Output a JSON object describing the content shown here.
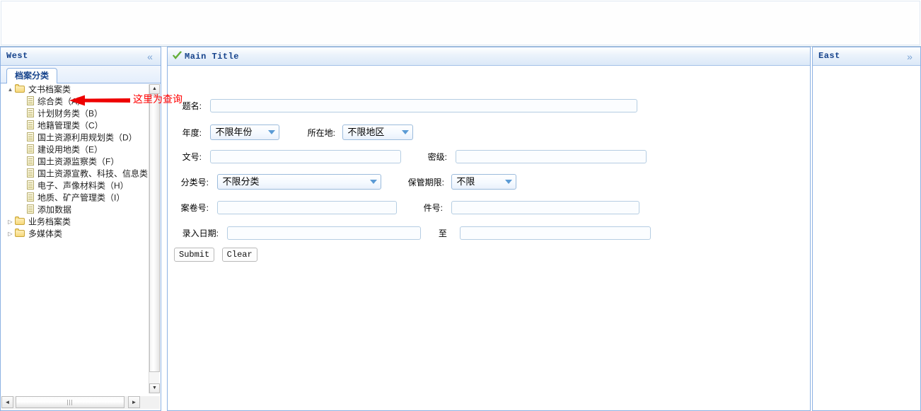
{
  "window": {
    "north_region_label": ""
  },
  "west": {
    "title": "West",
    "collapse_icon": "chevron-double-left-icon",
    "collapse_glyph": "«",
    "tab_label": "档案分类",
    "tree": [
      {
        "label": "文书档案类",
        "type": "folder",
        "expanded": true,
        "level": 1,
        "arrow": "▲"
      },
      {
        "label": "综合类（A）",
        "type": "doc",
        "level": 2,
        "arrow": ""
      },
      {
        "label": "计划财务类（B）",
        "type": "doc",
        "level": 2,
        "arrow": ""
      },
      {
        "label": "地籍管理类（C）",
        "type": "doc",
        "level": 2,
        "arrow": ""
      },
      {
        "label": "国土资源利用规划类（D）",
        "type": "doc",
        "level": 2,
        "arrow": ""
      },
      {
        "label": "建设用地类（E）",
        "type": "doc",
        "level": 2,
        "arrow": ""
      },
      {
        "label": "国土资源监察类（F）",
        "type": "doc",
        "level": 2,
        "arrow": ""
      },
      {
        "label": "国土资源宣教、科技、信息类（G）",
        "type": "doc",
        "level": 2,
        "arrow": ""
      },
      {
        "label": "电子、声像材料类（H）",
        "type": "doc",
        "level": 2,
        "arrow": ""
      },
      {
        "label": "地质、矿产管理类（I）",
        "type": "doc",
        "level": 2,
        "arrow": ""
      },
      {
        "label": "添加数据",
        "type": "doc",
        "level": 2,
        "arrow": ""
      },
      {
        "label": "业务档案类",
        "type": "folder",
        "expanded": false,
        "level": 1,
        "arrow": "▷"
      },
      {
        "label": "多媒体类",
        "type": "folder",
        "expanded": false,
        "level": 1,
        "arrow": "▷"
      }
    ],
    "scroll": {
      "up_glyph": "▲",
      "down_glyph": "▼",
      "left_glyph": "◄",
      "right_glyph": "►"
    }
  },
  "center": {
    "title": "Main Title",
    "check_icon": "green-check-icon",
    "form": {
      "rows": [
        {
          "label": "题名:",
          "value": "",
          "placeholder": ""
        },
        {
          "label": "年度:",
          "select_value": "不限年份"
        },
        {
          "label": "所在地:",
          "select_value": "不限地区"
        },
        {
          "label": "文号:",
          "value": "",
          "placeholder": ""
        },
        {
          "label": "密级:",
          "value": "",
          "placeholder": ""
        },
        {
          "label": "分类号:",
          "select_value": "不限分类"
        },
        {
          "label": "保管期限:",
          "select_value": "不限"
        },
        {
          "label": "案卷号:",
          "value": "",
          "placeholder": ""
        },
        {
          "label": "件号:",
          "value": "",
          "placeholder": ""
        },
        {
          "label": "录入日期:",
          "value": "",
          "placeholder": ""
        },
        {
          "label": "至",
          "value": "",
          "placeholder": ""
        }
      ],
      "labels": {
        "title_name": "题名:",
        "year": "年度:",
        "location": "所在地:",
        "doc_number": "文号:",
        "secrecy": "密级:",
        "category": "分类号:",
        "retention": "保管期限:",
        "file_number": "案卷号:",
        "item_number": "件号:",
        "entry_date": "录入日期:",
        "to": "至"
      },
      "values": {
        "year": "不限年份",
        "location": "不限地区",
        "category": "不限分类",
        "retention": "不限"
      },
      "submit_label": "Submit",
      "clear_label": "Clear"
    }
  },
  "east": {
    "title": "East",
    "expand_icon": "chevron-double-right-icon",
    "expand_glyph": "»"
  },
  "annotation": {
    "text": "这里为查询",
    "color": "#ff0000",
    "arrow_icon": "red-arrow-left-icon"
  }
}
